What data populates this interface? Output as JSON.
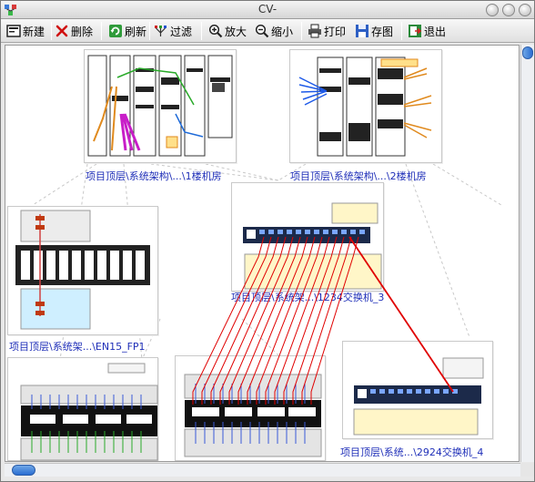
{
  "window": {
    "title": "CV-"
  },
  "toolbar": {
    "new_label": "新建",
    "delete_label": "删除",
    "refresh_label": "刷新",
    "filter_label": "过滤",
    "zoom_in_label": "放大",
    "zoom_out_label": "缩小",
    "print_label": "打印",
    "save_image_label": "存图",
    "exit_label": "退出"
  },
  "diagram": {
    "nodes": [
      {
        "caption": "项目顶层\\系统架构\\...\\1楼机房"
      },
      {
        "caption": "项目顶层\\系统架构\\...\\2楼机房"
      },
      {
        "caption": "项目顶层\\系统架...\\EN15_FP1"
      },
      {
        "caption": "项目顶层\\系统架...\\1234交换机_3"
      },
      {
        "caption": "项目顶层\\系统...\\2924交换机_4"
      }
    ],
    "colors": {
      "caption": "#1f2fb8",
      "patch_link": "#e00000",
      "tree_line": "#c0c0c0"
    }
  }
}
